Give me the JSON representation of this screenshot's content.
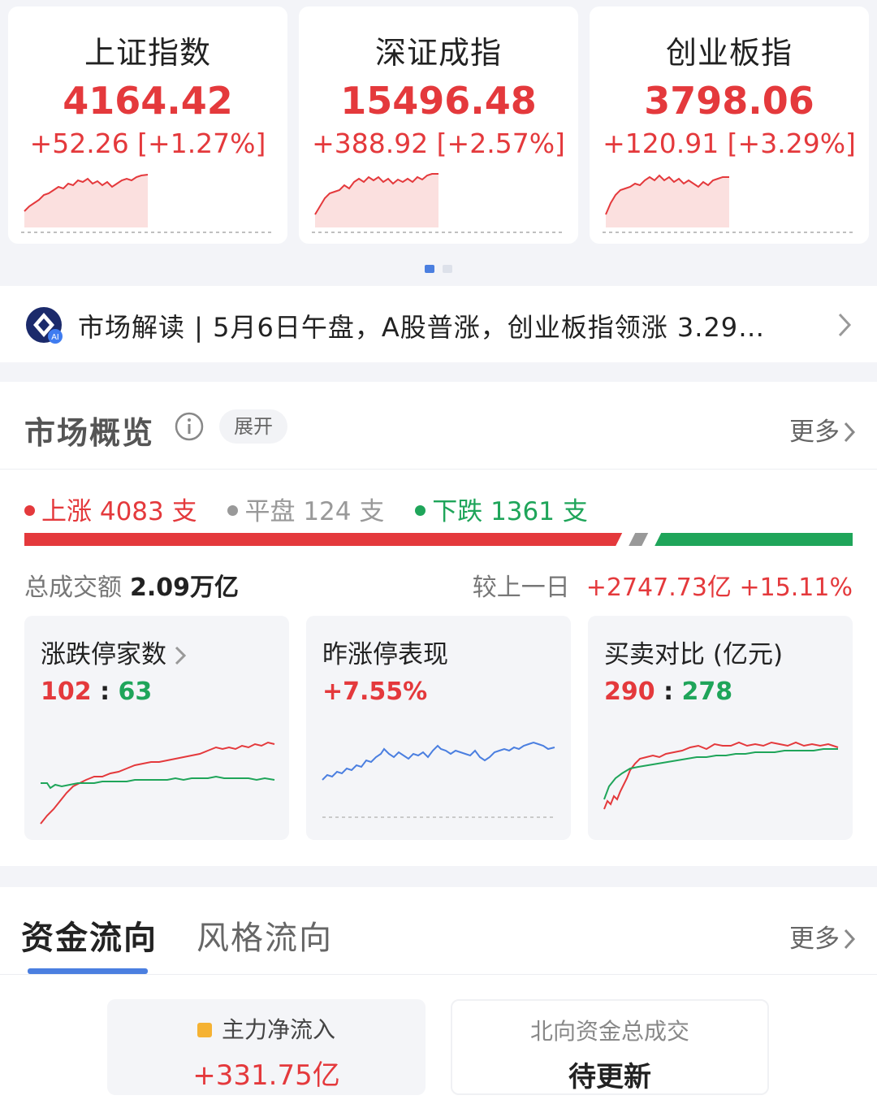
{
  "indices": [
    {
      "name": "上证指数",
      "value": "4164.42",
      "change": "+52.26 [+1.27%]"
    },
    {
      "name": "深证成指",
      "value": "15496.48",
      "change": "+388.92 [+2.57%]"
    },
    {
      "name": "创业板指",
      "value": "3798.06",
      "change": "+120.91 [+3.29%]"
    }
  ],
  "news": {
    "text": "市场解读 | 5月6日午盘，A股普涨，创业板指领涨 3.29…",
    "icon_badge": "AI"
  },
  "overview": {
    "title": "市场概览",
    "expand_label": "展开",
    "more_label": "更多",
    "rise_label": "上涨 4083 支",
    "flat_label": "平盘 124 支",
    "fall_label": "下跌 1361 支",
    "rise_count": 4083,
    "flat_count": 124,
    "fall_count": 1361,
    "turnover_label": "总成交额",
    "turnover_value": "2.09万亿",
    "compare_label": "较上一日",
    "compare_value": "+2747.73亿 +15.11%",
    "cards": [
      {
        "title": "涨跌停家数",
        "left": "102",
        "sep": ":",
        "right": "63"
      },
      {
        "title": "昨涨停表现",
        "value": "+7.55%"
      },
      {
        "title": "买卖对比 (亿元)",
        "left": "290",
        "sep": ":",
        "right": "278"
      }
    ]
  },
  "flow": {
    "tab_active": "资金流向",
    "tab_inactive": "风格流向",
    "more_label": "更多",
    "main_label": "主力净流入",
    "main_value": "+331.75亿",
    "north_label": "北向资金总成交",
    "north_value": "待更新"
  },
  "colors": {
    "up": "#e4393c",
    "down": "#1fa55a",
    "flat": "#999999",
    "accent": "#4b7fe0"
  }
}
